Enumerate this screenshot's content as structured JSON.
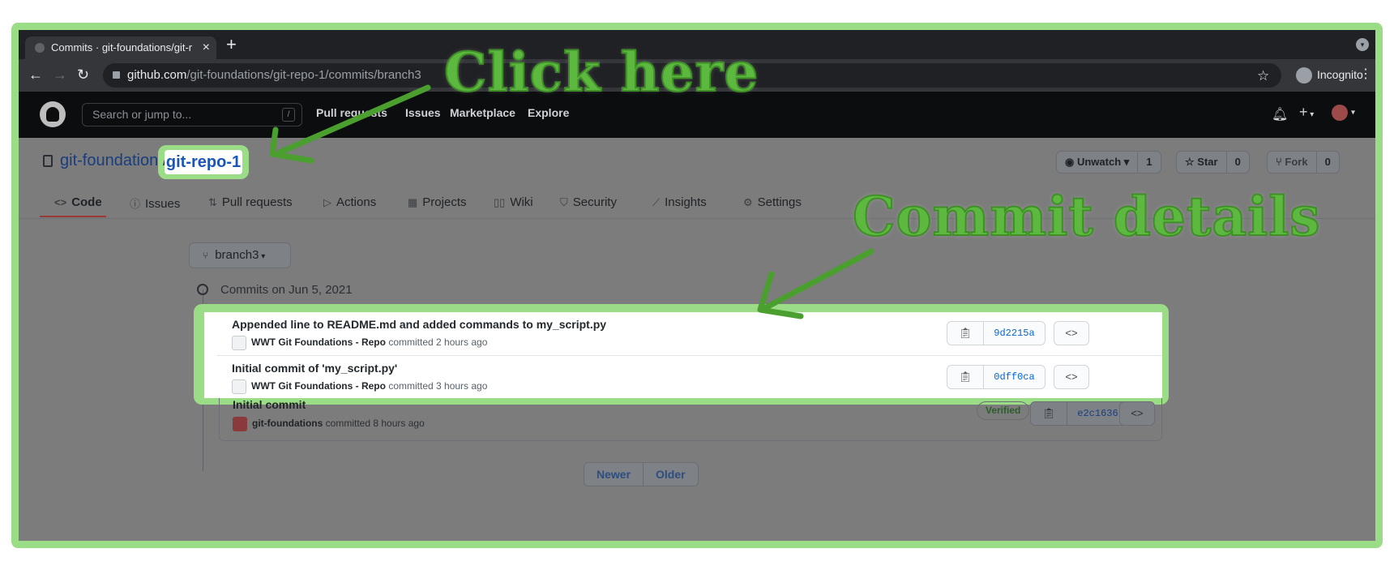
{
  "browser": {
    "tab_title": "Commits · git-foundations/git-r",
    "tab_close": "×",
    "new_tab": "+",
    "url_host": "github.com",
    "url_path": "/git-foundations/git-repo-1/commits/branch3",
    "profile_label": "Incognito"
  },
  "github_header": {
    "search_placeholder": "Search or jump to...",
    "search_key": "/",
    "nav": [
      "Pull requests",
      "Issues",
      "Marketplace",
      "Explore"
    ]
  },
  "repo": {
    "owner": "git-foundations",
    "separator": "/",
    "name": "git-repo-1",
    "watch_label": "Unwatch",
    "watch_count": "1",
    "star_label": "Star",
    "star_count": "0",
    "fork_label": "Fork",
    "fork_count": "0"
  },
  "repo_tabs": [
    {
      "label": "Code",
      "icon": "code-icon"
    },
    {
      "label": "Issues",
      "icon": "issue-icon"
    },
    {
      "label": "Pull requests",
      "icon": "pull-request-icon"
    },
    {
      "label": "Actions",
      "icon": "play-icon"
    },
    {
      "label": "Projects",
      "icon": "project-icon"
    },
    {
      "label": "Wiki",
      "icon": "book-icon"
    },
    {
      "label": "Security",
      "icon": "shield-icon"
    },
    {
      "label": "Insights",
      "icon": "graph-icon"
    },
    {
      "label": "Settings",
      "icon": "gear-icon"
    }
  ],
  "branch": {
    "name": "branch3"
  },
  "commits_heading": "Commits on Jun 5, 2021",
  "commits": [
    {
      "title": "Appended line to README.md and added commands to my_script.py",
      "author": "WWT Git Foundations - Repo",
      "action": "committed",
      "time": "2 hours ago",
      "sha": "9d2215a",
      "verified": ""
    },
    {
      "title": "Initial commit of 'my_script.py'",
      "author": "WWT Git Foundations - Repo",
      "action": "committed",
      "time": "3 hours ago",
      "sha": "0dff0ca",
      "verified": ""
    },
    {
      "title": "Initial commit",
      "author": "git-foundations",
      "action": "committed",
      "time": "8 hours ago",
      "sha": "e2c1636",
      "verified": "Verified"
    }
  ],
  "pagination": {
    "newer": "Newer",
    "older": "Older"
  },
  "annotations": {
    "click_here": "Click here",
    "commit_details": "Commit details"
  },
  "colors": {
    "annotation_green": "#5cb83f",
    "highlight": "#9bdc86",
    "link_blue": "#0366d6"
  }
}
